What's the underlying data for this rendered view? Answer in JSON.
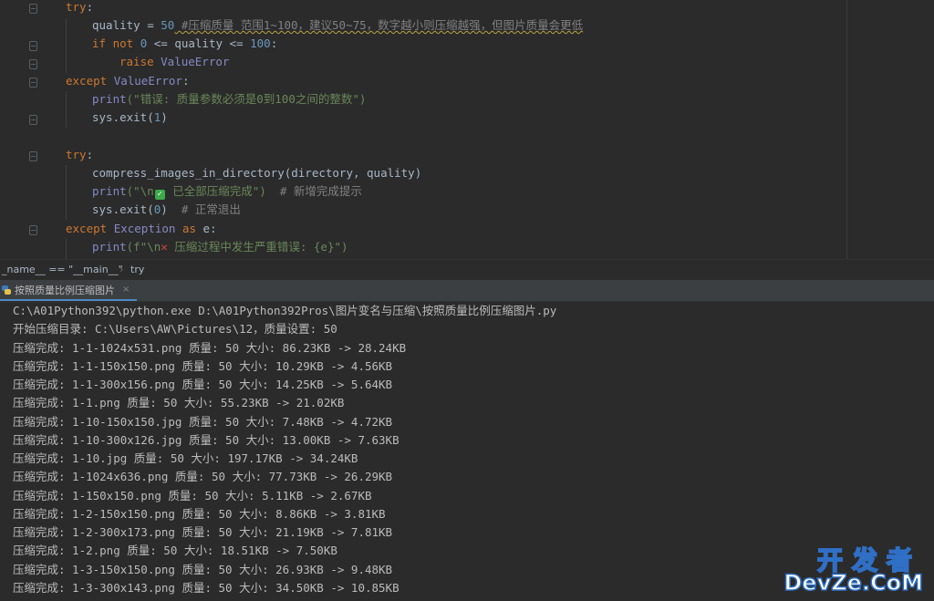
{
  "code": {
    "l1_try": "try",
    "l1_colon": ":",
    "l2_var": "quality = ",
    "l2_num": "50",
    "l2_comment": " #压缩质量 范围1~100，建议50~75，数字越小则压缩越强，但图片质量会更低",
    "l3_if": "if not ",
    "l3_zero": "0",
    "l3_mid": " <= quality <= ",
    "l3_hundred": "100",
    "l3_end": ":",
    "l4_raise": "raise ",
    "l4_err": "ValueError",
    "l5_except": "except ",
    "l5_err": "ValueError",
    "l5_end": ":",
    "l6_print": "print",
    "l6_str": "(\"错误: 质量参数必须是0到100之间的整数\")",
    "l7_sys": "sys.exit(",
    "l7_num": "1",
    "l7_end": ")",
    "l9_try": "try",
    "l9_colon": ":",
    "l10_call": "compress_images_in_directory(directory, quality)",
    "l11_print": "print",
    "l11_open": "(\"\\n",
    "l11_check": "✓",
    "l11_str": " 已全部压缩完成\")",
    "l11_comment": "  # 新增完成提示",
    "l12_sys": "sys.exit(",
    "l12_num": "0",
    "l12_end": ")",
    "l12_comment": "  # 正常退出",
    "l13_except": "except ",
    "l13_cls": "Exception",
    "l13_as": " as ",
    "l13_end": "e:",
    "l14_print": "print",
    "l14_open": "(f\"\\n",
    "l14_x": "✕",
    "l14_str": " 压缩过程中发生严重错误: {e}\")"
  },
  "breadcrumb": {
    "item1": "_name__ == \"__main__\"",
    "separator": "›",
    "item2": "try"
  },
  "run_tab": {
    "label": "按照质量比例压缩图片",
    "close": "×"
  },
  "console": {
    "lines": [
      "C:\\A01Python392\\python.exe D:\\A01Python392Pros\\图片变名与压缩\\按照质量比例压缩图片.py",
      "开始压缩目录: C:\\Users\\AW\\Pictures\\12，质量设置: 50",
      "压缩完成: 1-1-1024x531.png 质量: 50 大小: 86.23KB -> 28.24KB",
      "压缩完成: 1-1-150x150.png 质量: 50 大小: 10.29KB -> 4.56KB",
      "压缩完成: 1-1-300x156.png 质量: 50 大小: 14.25KB -> 5.64KB",
      "压缩完成: 1-1.png 质量: 50 大小: 55.23KB -> 21.02KB",
      "压缩完成: 1-10-150x150.jpg 质量: 50 大小: 7.48KB -> 4.72KB",
      "压缩完成: 1-10-300x126.jpg 质量: 50 大小: 13.00KB -> 7.63KB",
      "压缩完成: 1-10.jpg 质量: 50 大小: 197.17KB -> 34.24KB",
      "压缩完成: 1-1024x636.png 质量: 50 大小: 77.73KB -> 26.29KB",
      "压缩完成: 1-150x150.png 质量: 50 大小: 5.11KB -> 2.67KB",
      "压缩完成: 1-2-150x150.png 质量: 50 大小: 8.86KB -> 3.81KB",
      "压缩完成: 1-2-300x173.png 质量: 50 大小: 21.19KB -> 7.81KB",
      "压缩完成: 1-2.png 质量: 50 大小: 18.51KB -> 7.50KB",
      "压缩完成: 1-3-150x150.png 质量: 50 大小: 26.93KB -> 9.48KB",
      "压缩完成: 1-3-300x143.png 质量: 50 大小: 34.50KB -> 10.85KB"
    ]
  },
  "watermark": {
    "top": "开发者",
    "bottom": "DevZe.CoM"
  },
  "colors": {
    "background": "#2b2b2b",
    "keyword": "#cc7832",
    "number": "#6897bb",
    "string": "#6a8759",
    "comment": "#808080",
    "tab_accent": "#4a88c7"
  },
  "icons": {
    "run_tab_icon": "python-icon",
    "fold_markers": "fold-marker-icon"
  }
}
